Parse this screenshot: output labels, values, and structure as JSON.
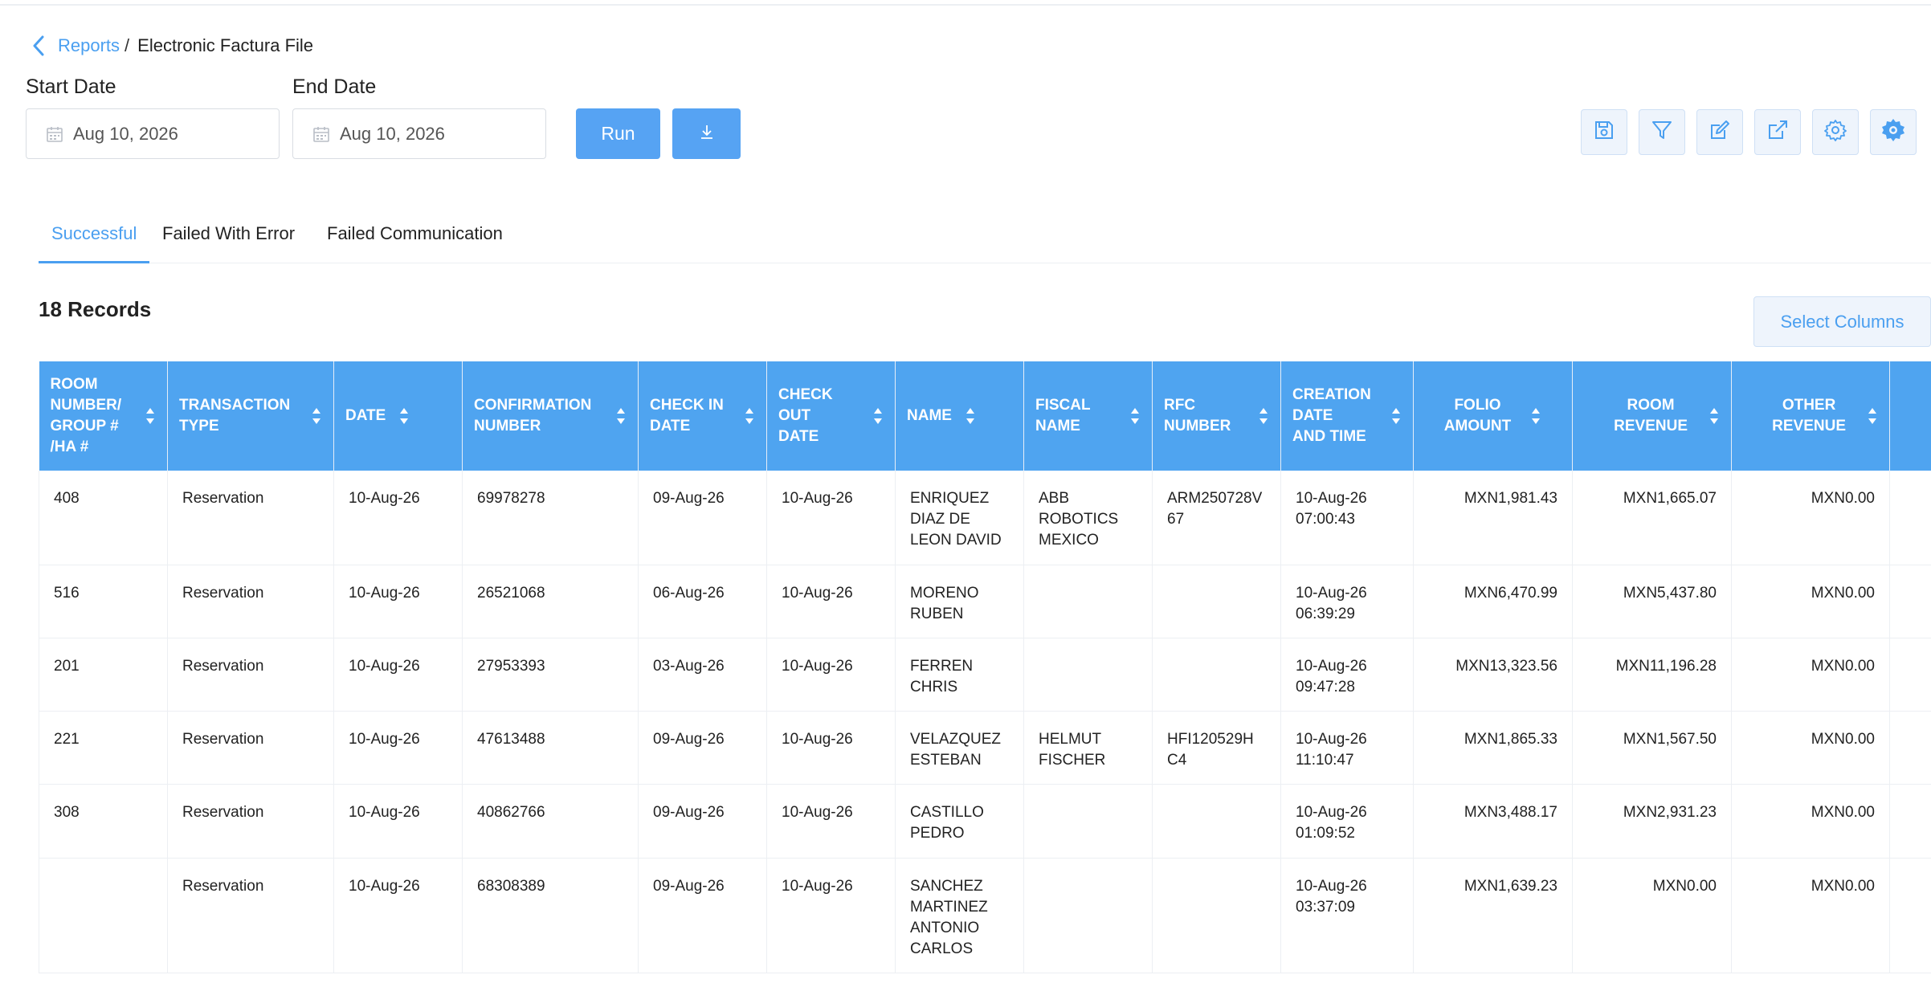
{
  "breadcrumb": {
    "parent": "Reports",
    "separator": "/",
    "current": "Electronic Factura File"
  },
  "filters": {
    "start_label": "Start Date",
    "start_value": "Aug 10, 2026",
    "end_label": "End Date",
    "end_value": "Aug 10, 2026",
    "run_label": "Run"
  },
  "toolbar": [
    "save-icon",
    "filter-icon",
    "edit-icon",
    "external-link-icon",
    "settings-icon",
    "cog-badge-icon"
  ],
  "tabs": [
    {
      "label": "Successful",
      "active": true
    },
    {
      "label": "Failed With Error",
      "active": false
    },
    {
      "label": "Failed Communication",
      "active": false
    }
  ],
  "records_label": "18 Records",
  "select_columns_label": "Select Columns",
  "colors": {
    "accent": "#4fa4f0",
    "accent_light": "#eef4fc"
  },
  "table": {
    "headers": [
      [
        "ROOM",
        "NUMBER/",
        "GROUP #",
        "/HA #"
      ],
      [
        "TRANSACTION",
        "TYPE"
      ],
      [
        "DATE"
      ],
      [
        "CONFIRMATION",
        "NUMBER"
      ],
      [
        "CHECK IN",
        "DATE"
      ],
      [
        "CHECK",
        "OUT",
        "DATE"
      ],
      [
        "NAME"
      ],
      [
        "FISCAL",
        "NAME"
      ],
      [
        "RFC",
        "NUMBER"
      ],
      [
        "CREATION",
        "DATE",
        "AND TIME"
      ],
      [
        "FOLIO",
        "AMOUNT"
      ],
      [
        "ROOM",
        "REVENUE"
      ],
      [
        "OTHER",
        "REVENUE"
      ]
    ],
    "rows": [
      {
        "room": "408",
        "type": "Reservation",
        "date": "10-Aug-26",
        "conf": "69978278",
        "checkin": "09-Aug-26",
        "checkout": "10-Aug-26",
        "name": [
          "ENRIQUEZ",
          "DIAZ DE",
          "LEON DAVID"
        ],
        "fiscal": [
          "ABB",
          "ROBOTICS",
          "MEXICO"
        ],
        "rfc": [
          "ARM250728V",
          "67"
        ],
        "created": [
          "10-Aug-26",
          "07:00:43"
        ],
        "folio": "MXN1,981.43",
        "room_rev": "MXN1,665.07",
        "other_rev": "MXN0.00"
      },
      {
        "room": "516",
        "type": "Reservation",
        "date": "10-Aug-26",
        "conf": "26521068",
        "checkin": "06-Aug-26",
        "checkout": "10-Aug-26",
        "name": [
          "MORENO",
          "RUBEN"
        ],
        "fiscal": [],
        "rfc": [],
        "created": [
          "10-Aug-26",
          "06:39:29"
        ],
        "folio": "MXN6,470.99",
        "room_rev": "MXN5,437.80",
        "other_rev": "MXN0.00"
      },
      {
        "room": "201",
        "type": "Reservation",
        "date": "10-Aug-26",
        "conf": "27953393",
        "checkin": "03-Aug-26",
        "checkout": "10-Aug-26",
        "name": [
          "FERREN",
          "CHRIS"
        ],
        "fiscal": [],
        "rfc": [],
        "created": [
          "10-Aug-26",
          "09:47:28"
        ],
        "folio": "MXN13,323.56",
        "room_rev": "MXN11,196.28",
        "other_rev": "MXN0.00"
      },
      {
        "room": "221",
        "type": "Reservation",
        "date": "10-Aug-26",
        "conf": "47613488",
        "checkin": "09-Aug-26",
        "checkout": "10-Aug-26",
        "name": [
          "VELAZQUEZ",
          "ESTEBAN"
        ],
        "fiscal": [
          "HELMUT",
          "FISCHER"
        ],
        "rfc": [
          "HFI120529H",
          "C4"
        ],
        "created": [
          "10-Aug-26",
          "11:10:47"
        ],
        "folio": "MXN1,865.33",
        "room_rev": "MXN1,567.50",
        "other_rev": "MXN0.00"
      },
      {
        "room": "308",
        "type": "Reservation",
        "date": "10-Aug-26",
        "conf": "40862766",
        "checkin": "09-Aug-26",
        "checkout": "10-Aug-26",
        "name": [
          "CASTILLO",
          "PEDRO"
        ],
        "fiscal": [],
        "rfc": [],
        "created": [
          "10-Aug-26",
          "01:09:52"
        ],
        "folio": "MXN3,488.17",
        "room_rev": "MXN2,931.23",
        "other_rev": "MXN0.00"
      },
      {
        "room": "",
        "type": "Reservation",
        "date": "10-Aug-26",
        "conf": "68308389",
        "checkin": "09-Aug-26",
        "checkout": "10-Aug-26",
        "name": [
          "SANCHEZ",
          "MARTINEZ",
          "ANTONIO",
          "CARLOS"
        ],
        "fiscal": [],
        "rfc": [],
        "created": [
          "10-Aug-26",
          "03:37:09"
        ],
        "folio": "MXN1,639.23",
        "room_rev": "MXN0.00",
        "other_rev": "MXN0.00"
      }
    ]
  }
}
